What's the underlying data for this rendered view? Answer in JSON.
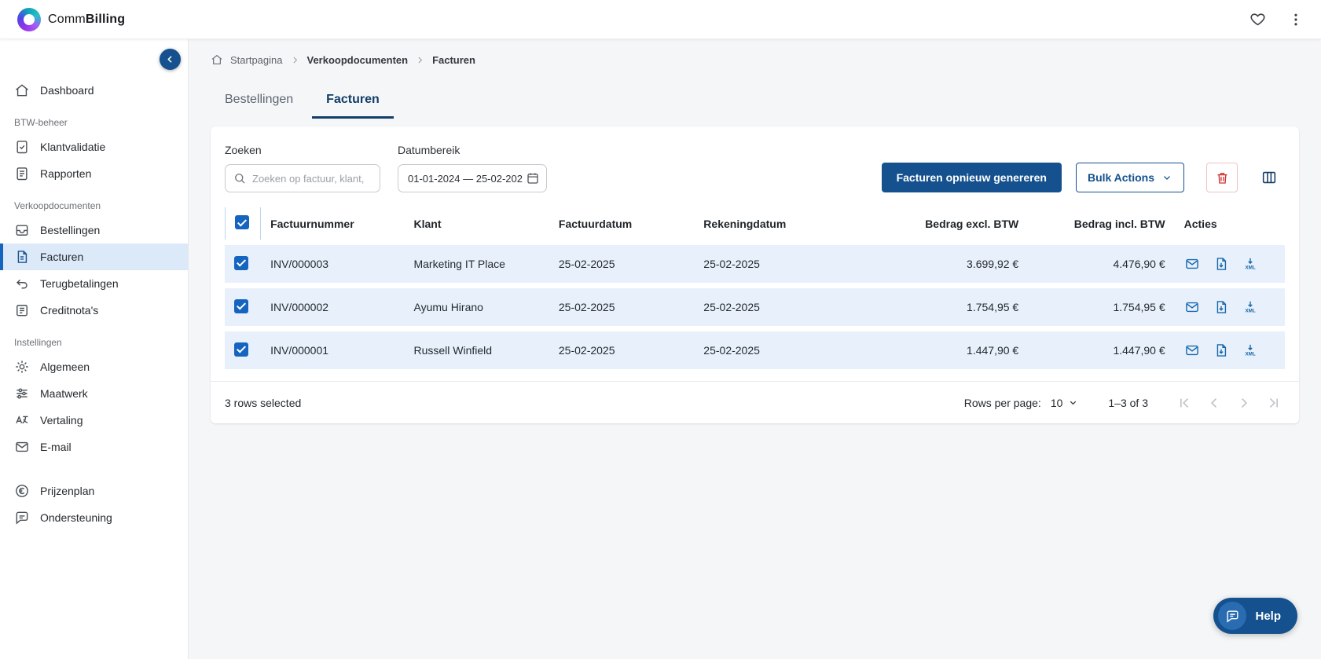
{
  "topbar": {
    "brand_prefix": "Comm",
    "brand_suffix": "Billing"
  },
  "sidebar": {
    "groups": [
      {
        "title": "",
        "items": [
          {
            "label": "Dashboard",
            "icon": "home"
          }
        ]
      },
      {
        "title": "BTW-beheer",
        "items": [
          {
            "label": "Klantvalidatie",
            "icon": "clipboard-check"
          },
          {
            "label": "Rapporten",
            "icon": "report"
          }
        ]
      },
      {
        "title": "Verkoopdocumenten",
        "items": [
          {
            "label": "Bestellingen",
            "icon": "orders"
          },
          {
            "label": "Facturen",
            "icon": "invoice",
            "active": true
          },
          {
            "label": "Terugbetalingen",
            "icon": "refund"
          },
          {
            "label": "Creditnota's",
            "icon": "credit-note"
          }
        ]
      },
      {
        "title": "Instellingen",
        "items": [
          {
            "label": "Algemeen",
            "icon": "gear"
          },
          {
            "label": "Maatwerk",
            "icon": "sliders"
          },
          {
            "label": "Vertaling",
            "icon": "translate"
          },
          {
            "label": "E-mail",
            "icon": "mail"
          }
        ]
      },
      {
        "title": "",
        "items": [
          {
            "label": "Prijzenplan",
            "icon": "euro"
          },
          {
            "label": "Ondersteuning",
            "icon": "support"
          }
        ]
      }
    ]
  },
  "breadcrumb": {
    "items": [
      "Startpagina",
      "Verkoopdocumenten",
      "Facturen"
    ]
  },
  "tabs": [
    {
      "label": "Bestellingen",
      "active": false
    },
    {
      "label": "Facturen",
      "active": true
    }
  ],
  "filters": {
    "search_label": "Zoeken",
    "search_placeholder": "Zoeken op factuur, klant,",
    "date_label": "Datumbereik",
    "date_value": "01-01-2024 — 25-02-202"
  },
  "toolbar": {
    "regenerate_label": "Facturen opnieuw genereren",
    "bulk_actions_label": "Bulk Actions"
  },
  "table": {
    "headers": {
      "invoice": "Factuurnummer",
      "customer": "Klant",
      "invoice_date": "Factuurdatum",
      "billing_date": "Rekeningdatum",
      "amount_excl": "Bedrag excl. BTW",
      "amount_incl": "Bedrag incl. BTW",
      "actions": "Acties"
    },
    "rows": [
      {
        "invoice": "INV/000003",
        "customer": "Marketing IT Place",
        "invoice_date": "25-02-2025",
        "billing_date": "25-02-2025",
        "amount_excl": "3.699,92 €",
        "amount_incl": "4.476,90 €",
        "selected": true
      },
      {
        "invoice": "INV/000002",
        "customer": "Ayumu Hirano",
        "invoice_date": "25-02-2025",
        "billing_date": "25-02-2025",
        "amount_excl": "1.754,95 €",
        "amount_incl": "1.754,95 €",
        "selected": true
      },
      {
        "invoice": "INV/000001",
        "customer": "Russell Winfield",
        "invoice_date": "25-02-2025",
        "billing_date": "25-02-2025",
        "amount_excl": "1.447,90 €",
        "amount_incl": "1.447,90 €",
        "selected": true
      }
    ]
  },
  "pagination": {
    "selected_text": "3 rows selected",
    "rows_per_page_label": "Rows per page:",
    "rows_per_page_value": "10",
    "range_text": "1–3 of 3"
  },
  "help": {
    "label": "Help"
  },
  "colors": {
    "primary": "#15518e",
    "accent_blue": "#1565c0",
    "danger": "#d32f2f",
    "selected_row_bg": "#e8f1fb",
    "sidebar_active_bg": "#dce9f8"
  }
}
